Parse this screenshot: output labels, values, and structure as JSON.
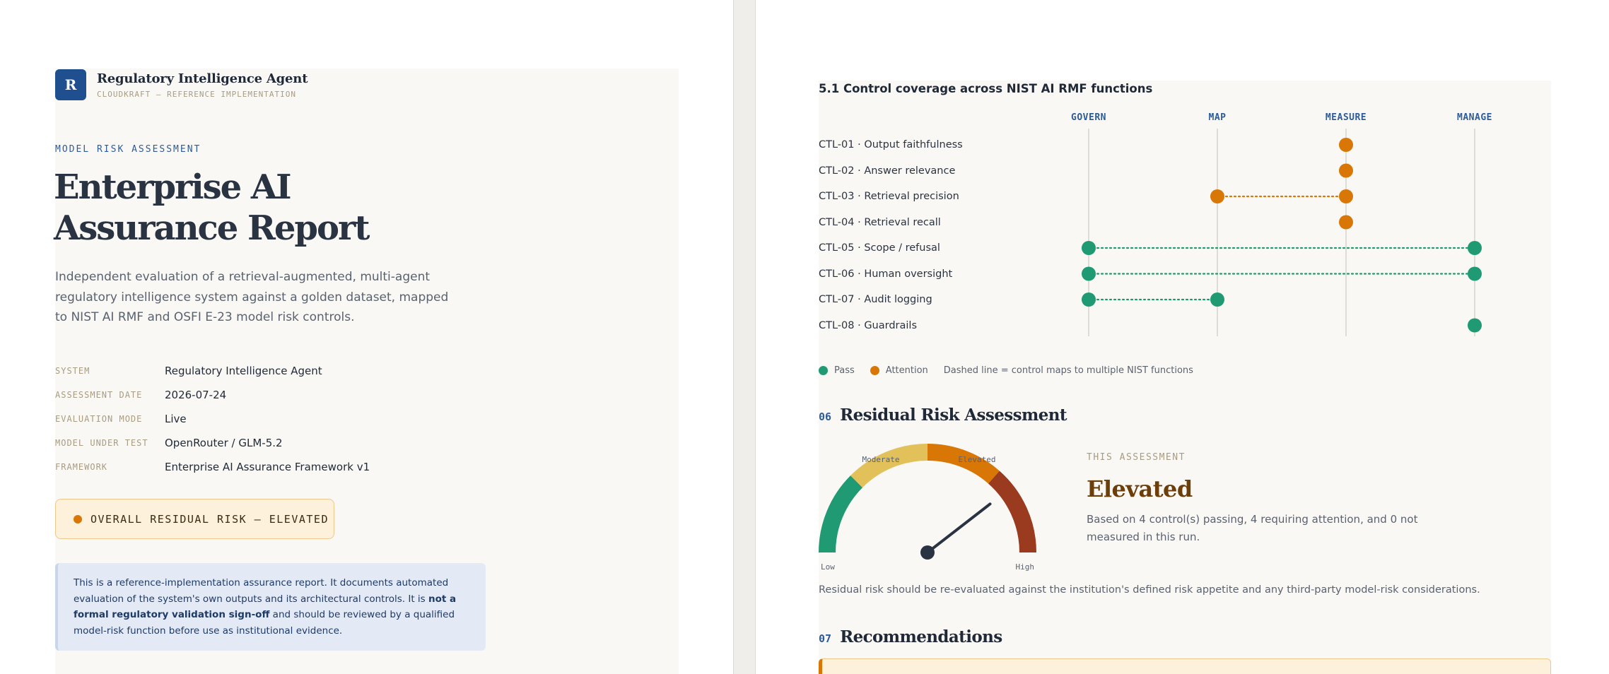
{
  "left": {
    "brand": {
      "logo_letter": "R",
      "name": "Regulatory Intelligence Agent",
      "sub": "CLOUDKRAFT — REFERENCE IMPLEMENTATION"
    },
    "eyebrow": "MODEL RISK ASSESSMENT",
    "title_line1": "Enterprise AI",
    "title_line2": "Assurance Report",
    "lede": "Independent evaluation of a retrieval-augmented, multi-agent regulatory intelligence system against a golden dataset, mapped to NIST AI RMF and OSFI E-23 model risk controls.",
    "meta": [
      {
        "key": "SYSTEM",
        "value": "Regulatory Intelligence Agent"
      },
      {
        "key": "ASSESSMENT DATE",
        "value": "2026-07-24"
      },
      {
        "key": "EVALUATION MODE",
        "value": "Live"
      },
      {
        "key": "MODEL UNDER TEST",
        "value": "OpenRouter / GLM-5.2"
      },
      {
        "key": "FRAMEWORK",
        "value": "Enterprise AI Assurance Framework v1"
      }
    ],
    "risk_pill": "OVERALL RESIDUAL RISK — ELEVATED",
    "callout": {
      "part1": "This is a reference-implementation assurance report. It documents automated evaluation of the system's own outputs and its architectural controls. It is ",
      "bold": "not a formal regulatory validation sign-off",
      "part2": " and should be reviewed by a qualified model-risk function before use as institutional evidence."
    }
  },
  "right": {
    "coverage": {
      "section_title": "5.1  Control coverage across NIST AI RMF functions",
      "functions": [
        "GOVERN",
        "MAP",
        "MEASURE",
        "MANAGE"
      ],
      "controls": [
        {
          "label": "CTL-01 · Output faithfulness",
          "status": "attention",
          "functions": [
            "MEASURE"
          ]
        },
        {
          "label": "CTL-02 · Answer relevance",
          "status": "attention",
          "functions": [
            "MEASURE"
          ]
        },
        {
          "label": "CTL-03 · Retrieval precision",
          "status": "attention",
          "functions": [
            "MAP",
            "MEASURE"
          ]
        },
        {
          "label": "CTL-04 · Retrieval recall",
          "status": "attention",
          "functions": [
            "MEASURE"
          ]
        },
        {
          "label": "CTL-05 · Scope / refusal",
          "status": "pass",
          "functions": [
            "GOVERN",
            "MANAGE"
          ]
        },
        {
          "label": "CTL-06 · Human oversight",
          "status": "pass",
          "functions": [
            "GOVERN",
            "MANAGE"
          ]
        },
        {
          "label": "CTL-07 · Audit logging",
          "status": "pass",
          "functions": [
            "GOVERN",
            "MAP"
          ]
        },
        {
          "label": "CTL-08 · Guardrails",
          "status": "pass",
          "functions": [
            "MANAGE"
          ]
        }
      ],
      "legend": {
        "pass": "Pass",
        "attention": "Attention",
        "note": "Dashed line = control maps to multiple NIST functions"
      },
      "colors": {
        "pass": "#1f9a72",
        "attention": "#d97706",
        "grid": "#d6d3cc"
      }
    },
    "residual": {
      "num": "06",
      "heading": "Residual Risk Assessment",
      "gauge": {
        "labels": {
          "low": "Low",
          "moderate": "Moderate",
          "elevated": "Elevated",
          "high": "High"
        },
        "needle_fraction": 0.79,
        "colors": [
          "#1f9a72",
          "#e2c15a",
          "#d97706",
          "#9a3a1e"
        ]
      },
      "eyebrow": "THIS ASSESSMENT",
      "level": "Elevated",
      "summary": "Based on 4 control(s) passing, 4 requiring attention, and 0 not measured in this run.",
      "note": "Residual risk should be re-evaluated against the institution's defined risk appetite and any third-party model-risk considerations."
    },
    "recommendations": {
      "num": "07",
      "heading": "Recommendations"
    }
  }
}
